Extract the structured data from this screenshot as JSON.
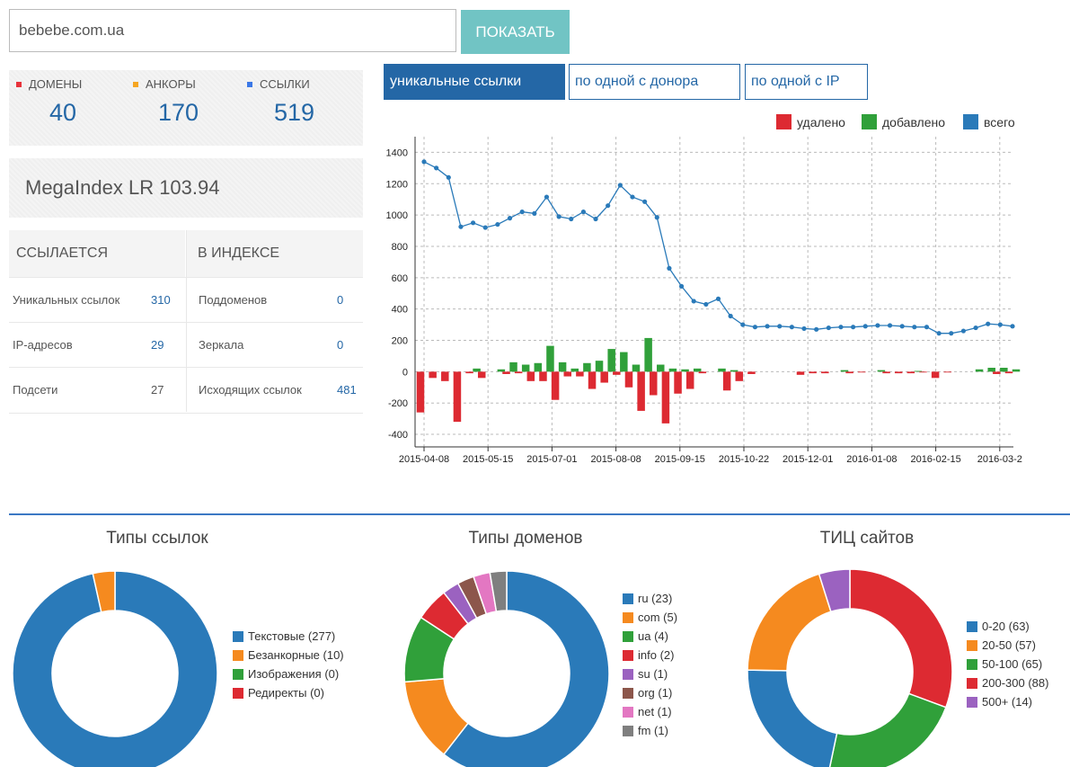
{
  "search": {
    "value": "bebebe.com.ua",
    "button": "ПОКАЗАТЬ"
  },
  "stats": [
    {
      "label": "ДОМЕНЫ",
      "value": "40",
      "color": "#e8333b"
    },
    {
      "label": "АНКОРЫ",
      "value": "170",
      "color": "#f5a623"
    },
    {
      "label": "ССЫЛКИ",
      "value": "519",
      "color": "#3b78e7"
    }
  ],
  "megaindex": "MegaIndex LR 103.94",
  "table": {
    "left_header": "ССЫЛАЕТСЯ",
    "right_header": "В ИНДЕКСЕ",
    "rows": [
      {
        "l_label": "Уникальных ссылок",
        "l_value": "310",
        "r_label": "Поддоменов",
        "r_value": "0"
      },
      {
        "l_label": "IP-адресов",
        "l_value": "29",
        "r_label": "Зеркала",
        "r_value": "0"
      },
      {
        "l_label": "Подсети",
        "l_value": "27",
        "r_label": "Исходящих ссылок",
        "r_value": "481"
      }
    ]
  },
  "tabs": [
    {
      "label": "уникальные ссылки",
      "active": true
    },
    {
      "label": "по одной с донора",
      "active": false
    },
    {
      "label": "по одной с IP",
      "active": false
    }
  ],
  "chart_data": [
    {
      "type": "line",
      "legend": [
        {
          "label": "удалено",
          "color": "#dd2a32"
        },
        {
          "label": "добавлено",
          "color": "#30a03a"
        },
        {
          "label": "всего",
          "color": "#2a7ab9"
        }
      ],
      "legend_position": "top-right",
      "grid": true,
      "ylim": [
        -480,
        1500
      ],
      "y_ticks": [
        "1400",
        "1200",
        "1000",
        "800",
        "600",
        "400",
        "200",
        "0",
        "-200",
        "-400"
      ],
      "x_ticks": [
        "2015-04-08",
        "2015-05-15",
        "2015-07-01",
        "2015-08-08",
        "2015-09-15",
        "2015-10-22",
        "2015-12-01",
        "2016-01-08",
        "2016-02-15",
        "2016-03-2"
      ],
      "total": [
        1340,
        1300,
        1240,
        925,
        950,
        920,
        940,
        980,
        1020,
        1010,
        1115,
        990,
        975,
        1020,
        975,
        1060,
        1190,
        1115,
        1085,
        985,
        660,
        545,
        450,
        430,
        465,
        355,
        300,
        285,
        290,
        290,
        285,
        275,
        270,
        280,
        285,
        285,
        290,
        295,
        295,
        290,
        285,
        285,
        245,
        245,
        260,
        280,
        305,
        300,
        290
      ],
      "added": [
        0,
        0,
        0,
        0,
        20,
        0,
        15,
        60,
        45,
        55,
        165,
        60,
        20,
        55,
        70,
        145,
        125,
        45,
        215,
        45,
        20,
        15,
        20,
        0,
        20,
        10,
        0,
        0,
        0,
        0,
        0,
        0,
        0,
        0,
        10,
        0,
        0,
        10,
        0,
        0,
        5,
        0,
        0,
        0,
        0,
        15,
        25,
        25,
        15
      ],
      "removed": [
        -260,
        -40,
        -60,
        -320,
        -10,
        -40,
        0,
        -15,
        -10,
        -60,
        -60,
        -180,
        -30,
        -30,
        -110,
        -70,
        -20,
        -100,
        -250,
        -150,
        -330,
        -140,
        -110,
        -10,
        0,
        -120,
        -60,
        -15,
        0,
        0,
        0,
        -20,
        -10,
        -10,
        0,
        -10,
        -5,
        0,
        -10,
        -10,
        -10,
        -5,
        -40,
        -5,
        0,
        0,
        0,
        -15,
        -10
      ]
    },
    {
      "type": "pie",
      "title": "Типы ссылок",
      "labels": [
        "Текстовые (277)",
        "Безанкорные (10)",
        "Изображения (0)",
        "Редиректы (0)"
      ],
      "values": [
        277,
        10,
        0,
        0
      ],
      "colors": [
        "#2a7ab9",
        "#f58a1f",
        "#30a03a",
        "#dd2a32"
      ]
    },
    {
      "type": "pie",
      "title": "Типы доменов",
      "labels": [
        "ru (23)",
        "com (5)",
        "ua (4)",
        "info (2)",
        "su (1)",
        "org (1)",
        "net (1)",
        "fm (1)"
      ],
      "values": [
        23,
        5,
        4,
        2,
        1,
        1,
        1,
        1
      ],
      "colors": [
        "#2a7ab9",
        "#f58a1f",
        "#30a03a",
        "#dd2a32",
        "#9b62c0",
        "#8c564b",
        "#e377c2",
        "#7f7f7f"
      ]
    },
    {
      "type": "pie",
      "title": "ТИЦ сайтов",
      "labels": [
        "0-20 (63)",
        "20-50 (57)",
        "50-100 (65)",
        "200-300 (88)",
        "500+ (14)"
      ],
      "values": [
        63,
        57,
        65,
        88,
        14
      ],
      "colors": [
        "#2a7ab9",
        "#f58a1f",
        "#30a03a",
        "#dd2a32",
        "#9b62c0"
      ],
      "order": [
        3,
        2,
        0,
        1,
        4
      ]
    }
  ]
}
